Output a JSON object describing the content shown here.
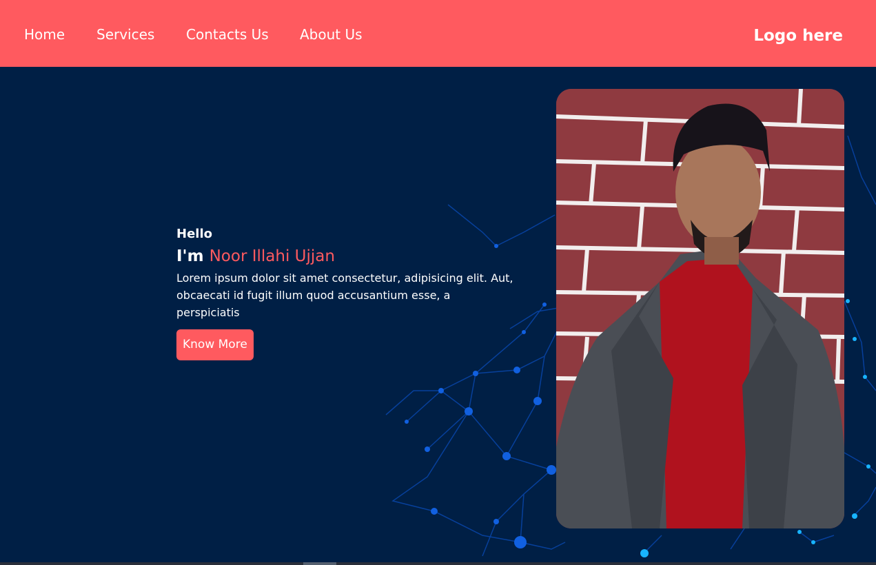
{
  "nav": {
    "items": [
      {
        "label": "Home"
      },
      {
        "label": "Services"
      },
      {
        "label": "Contacts Us"
      },
      {
        "label": "About Us"
      }
    ],
    "logo": "Logo here"
  },
  "hero": {
    "greeting": "Hello",
    "name_prefix": "I'm",
    "name": "Noor Illahi Ujjan",
    "description": "Lorem ipsum dolor sit amet consectetur, adipisicing elit. Aut, obcaecati id fugit illum quod accusantium esse, a perspiciatis",
    "cta_label": "Know More"
  },
  "colors": {
    "accent": "#ff5a5f",
    "background": "#001f45",
    "text": "#ffffff"
  }
}
